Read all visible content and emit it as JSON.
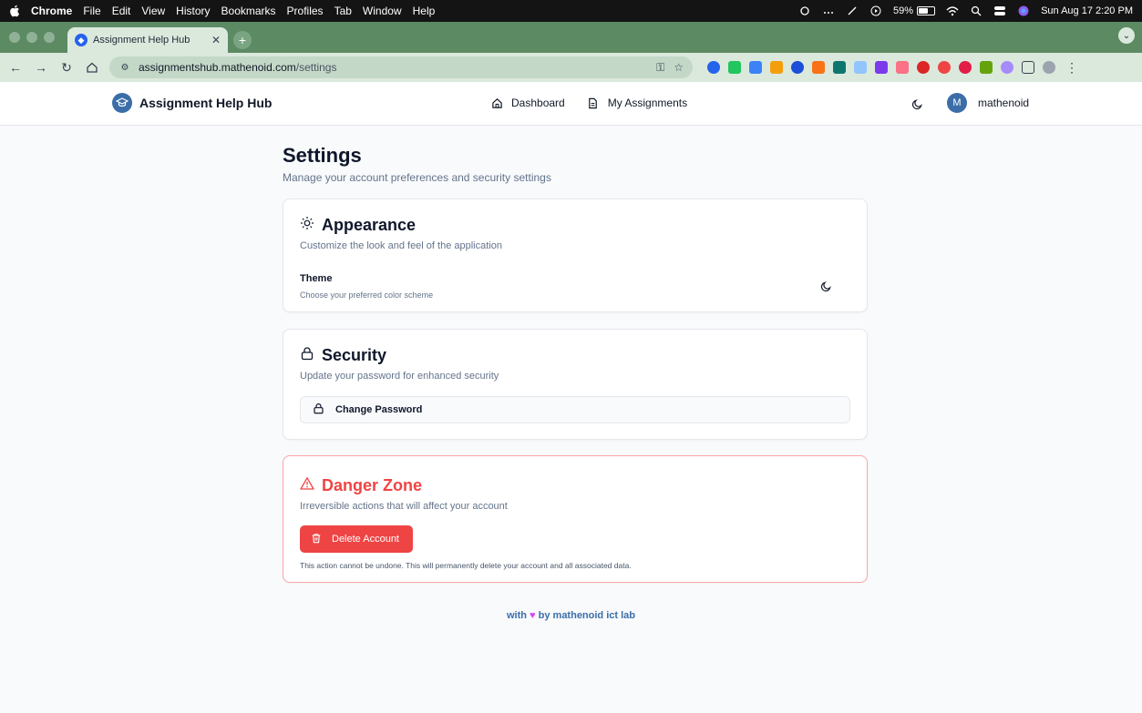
{
  "menubar": {
    "app": "Chrome",
    "items": [
      "File",
      "Edit",
      "View",
      "History",
      "Bookmarks",
      "Profiles",
      "Tab",
      "Window",
      "Help"
    ],
    "battery": "59%",
    "datetime": "Sun Aug 17  2:20 PM"
  },
  "browser": {
    "tab_title": "Assignment Help Hub",
    "url_host": "assignmentshub.mathenoid.com",
    "url_path": "/settings"
  },
  "header": {
    "brand": "Assignment Help Hub",
    "nav": [
      {
        "label": "Dashboard",
        "icon": "home-icon"
      },
      {
        "label": "My Assignments",
        "icon": "file-icon"
      }
    ],
    "avatar_initial": "M",
    "username": "mathenoid"
  },
  "page": {
    "title": "Settings",
    "subtitle": "Manage your account preferences and security settings"
  },
  "appearance": {
    "title": "Appearance",
    "description": "Customize the look and feel of the application",
    "theme_label": "Theme",
    "theme_help": "Choose your preferred color scheme"
  },
  "security": {
    "title": "Security",
    "description": "Update your password for enhanced security",
    "button": "Change Password"
  },
  "danger": {
    "title": "Danger Zone",
    "description": "Irreversible actions that will affect your account",
    "button": "Delete Account",
    "note": "This action cannot be undone. This will permanently delete your account and all associated data."
  },
  "footer": {
    "prefix": "with",
    "suffix": "by mathenoid ict lab"
  },
  "colors": {
    "accent": "#3b6ea8",
    "danger": "#ef4444",
    "tabstrip": "#5b8a63"
  }
}
